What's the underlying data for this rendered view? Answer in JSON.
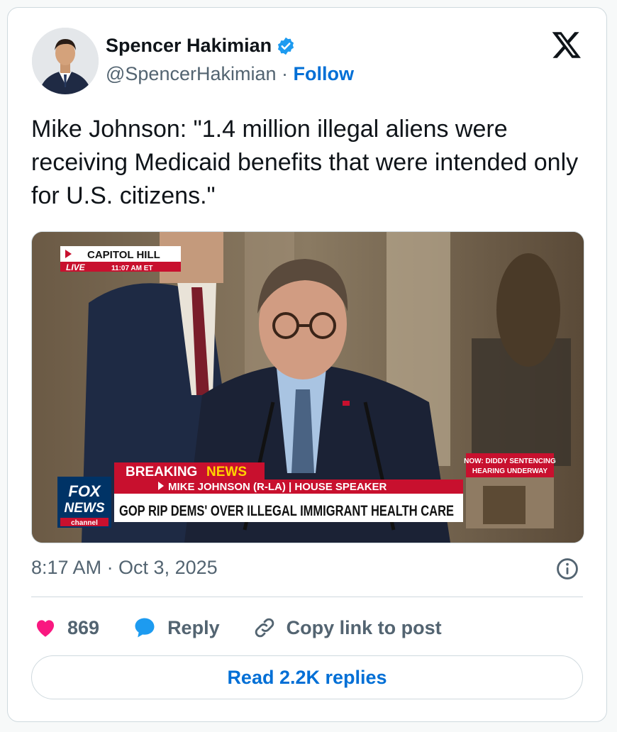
{
  "author": {
    "display_name": "Spencer Hakimian",
    "handle": "@SpencerHakimian",
    "separator": "·",
    "follow_label": "Follow",
    "verified": true
  },
  "tweet": {
    "text": "Mike Johnson: \"1.4 million illegal aliens were receiving Medicaid benefits that were intended only for U.S. citizens.\"",
    "timestamp": "8:17 AM · Oct 3, 2025"
  },
  "media": {
    "location": "CAPITOL HILL",
    "live_label": "LIVE",
    "live_time": "11:07 AM ET",
    "breaking_word1": "BREAKING",
    "breaking_word2": "NEWS",
    "speaker_line": "MIKE JOHNSON (R-LA) | HOUSE SPEAKER",
    "headline": "GOP RIP DEMS' OVER ILLEGAL IMMIGRANT HEALTH CARE",
    "side_line1": "NOW: DIDDY SENTENCING",
    "side_line2": "HEARING UNDERWAY",
    "logo_fox": "FOX",
    "logo_news": "NEWS",
    "logo_channel": "channel"
  },
  "actions": {
    "like_count": "869",
    "reply_label": "Reply",
    "copy_label": "Copy link to post"
  },
  "read_replies_label": "Read 2.2K replies",
  "colors": {
    "like": "#f91880",
    "reply": "#1d9bf0",
    "link": "#006fd6",
    "fox_red": "#c8102e"
  },
  "icons": [
    "verified-badge-icon",
    "x-logo-icon",
    "info-icon",
    "heart-icon",
    "reply-bubble-icon",
    "link-icon"
  ]
}
